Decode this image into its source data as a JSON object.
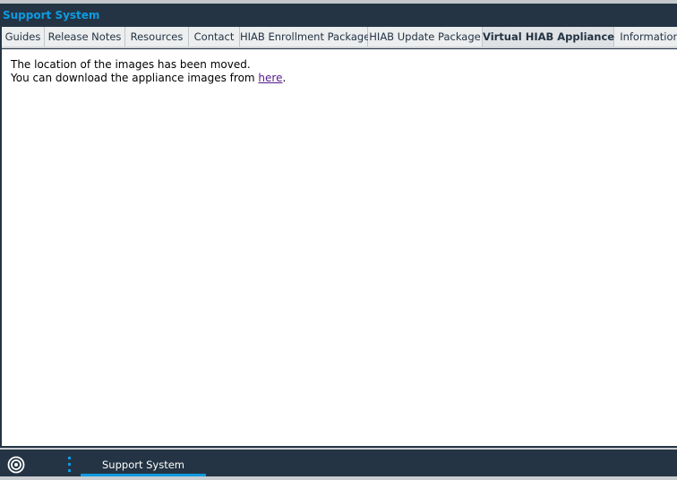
{
  "window": {
    "title": "Support System"
  },
  "tabs": [
    {
      "label": "Guides",
      "active": false
    },
    {
      "label": "Release Notes",
      "active": false
    },
    {
      "label": "Resources",
      "active": false
    },
    {
      "label": "Contact",
      "active": false
    },
    {
      "label": "HIAB Enrollment Package",
      "active": false
    },
    {
      "label": "HIAB Update Package",
      "active": false
    },
    {
      "label": "Virtual HIAB Appliance",
      "active": true
    },
    {
      "label": "Information",
      "active": false
    }
  ],
  "content": {
    "line1": "The location of the images has been moved.",
    "line2_prefix": "You can download the appliance images from ",
    "link": "here",
    "line2_suffix": "."
  },
  "taskbar": {
    "logo_icon": "target-logo-icon",
    "menu_icon": "vertical-dots-icon",
    "task_label": "Support System"
  },
  "colors": {
    "accent": "#0d9be0",
    "dark": "#243444"
  }
}
